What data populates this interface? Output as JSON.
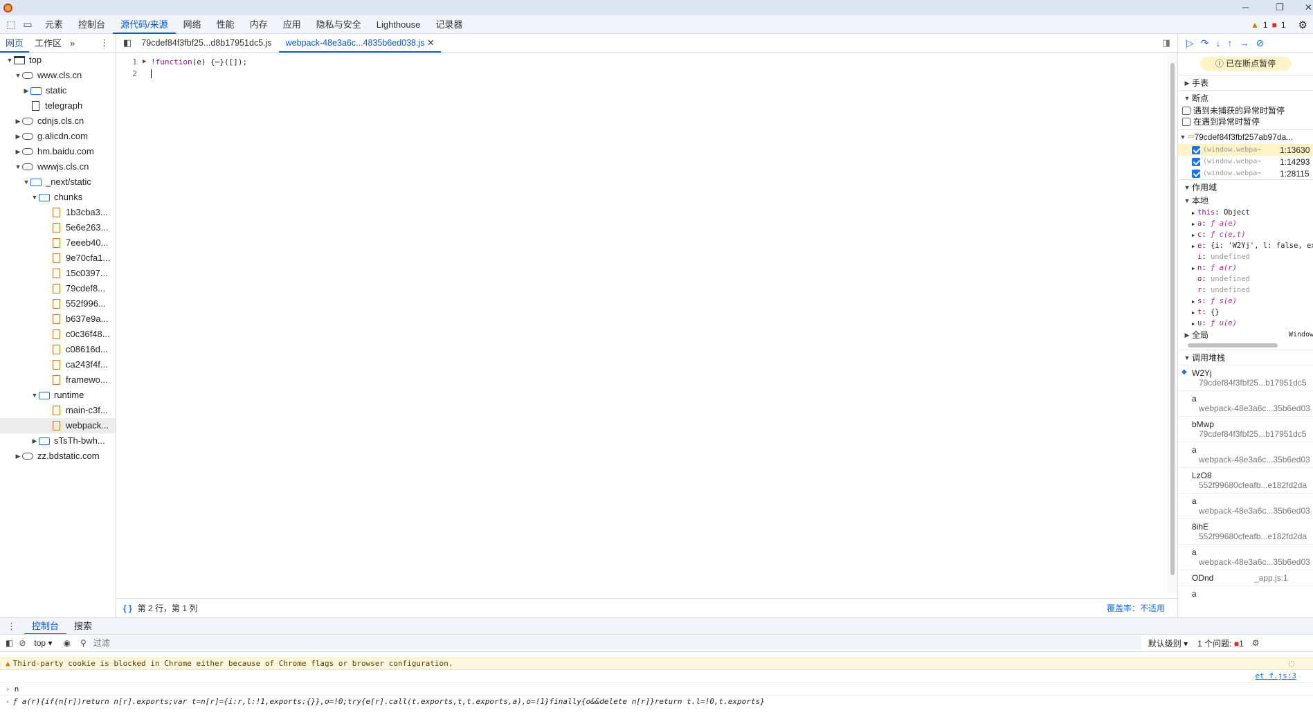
{
  "toolbar": {
    "tabs": [
      "元素",
      "控制台",
      "源代码/来源",
      "网络",
      "性能",
      "内存",
      "应用",
      "隐私与安全",
      "Lighthouse",
      "记录器"
    ],
    "active_tab": "源代码/来源",
    "warn_count": "1",
    "error_count": "1"
  },
  "navigator": {
    "tabs": [
      "网页",
      "工作区"
    ],
    "active_tab": "网页",
    "tree": [
      {
        "label": "top",
        "depth": 0,
        "type": "page",
        "expanded": true
      },
      {
        "label": "www.cls.cn",
        "depth": 1,
        "type": "cloud",
        "expanded": true
      },
      {
        "label": "static",
        "depth": 2,
        "type": "folder",
        "expanded": false
      },
      {
        "label": "telegraph",
        "depth": 2,
        "type": "doc"
      },
      {
        "label": "cdnjs.cls.cn",
        "depth": 1,
        "type": "cloud",
        "expanded": false
      },
      {
        "label": "g.alicdn.com",
        "depth": 1,
        "type": "cloud",
        "expanded": false
      },
      {
        "label": "hm.baidu.com",
        "depth": 1,
        "type": "cloud",
        "expanded": false
      },
      {
        "label": "wwwjs.cls.cn",
        "depth": 1,
        "type": "cloud",
        "expanded": true
      },
      {
        "label": "_next/static",
        "depth": 2,
        "type": "folder",
        "expanded": true
      },
      {
        "label": "chunks",
        "depth": 3,
        "type": "folder",
        "expanded": true
      },
      {
        "label": "1b3cba3...",
        "depth": 4,
        "type": "file"
      },
      {
        "label": "5e6e263...",
        "depth": 4,
        "type": "file"
      },
      {
        "label": "7eeeb40...",
        "depth": 4,
        "type": "file"
      },
      {
        "label": "9e70cfa1...",
        "depth": 4,
        "type": "file"
      },
      {
        "label": "15c0397...",
        "depth": 4,
        "type": "file"
      },
      {
        "label": "79cdef8...",
        "depth": 4,
        "type": "file"
      },
      {
        "label": "552f996...",
        "depth": 4,
        "type": "file"
      },
      {
        "label": "b637e9a...",
        "depth": 4,
        "type": "file"
      },
      {
        "label": "c0c36f48...",
        "depth": 4,
        "type": "file"
      },
      {
        "label": "c08616d...",
        "depth": 4,
        "type": "file"
      },
      {
        "label": "ca243f4f...",
        "depth": 4,
        "type": "file"
      },
      {
        "label": "framewo...",
        "depth": 4,
        "type": "file"
      },
      {
        "label": "runtime",
        "depth": 3,
        "type": "folder",
        "expanded": true
      },
      {
        "label": "main-c3f...",
        "depth": 4,
        "type": "file"
      },
      {
        "label": "webpack...",
        "depth": 4,
        "type": "file",
        "selected": true
      },
      {
        "label": "sTsTh-bwh...",
        "depth": 3,
        "type": "folder",
        "expanded": false
      },
      {
        "label": "zz.bdstatic.com",
        "depth": 1,
        "type": "cloud",
        "expanded": false
      }
    ]
  },
  "editor": {
    "tabs": [
      "79cdef84f3fbf25...d8b17951dc5.js",
      "webpack-48e3a6c...4835b6ed038.js"
    ],
    "active_tab": "webpack-48e3a6c...4835b6ed038.js",
    "lines": [
      {
        "num": "1",
        "code": "!function(e) {⋯}([]);"
      },
      {
        "num": "2",
        "code": ""
      }
    ],
    "status_position": "第 2 行，第 1 列",
    "coverage": "覆盖率：不适用"
  },
  "debugger": {
    "paused_label": "已在断点暂停",
    "watch_label": "手表",
    "breakpoints_label": "断点",
    "pause_uncaught": "遇到未捕获的异常时暂停",
    "pause_caught": "在遇到异常时暂停",
    "bp_file": "79cdef84f3fbf257ab97da...",
    "breakpoints": [
      {
        "code": "(window.webpa⋯",
        "line": "1:13630",
        "active": true
      },
      {
        "code": "(window.webpa⋯",
        "line": "1:14293"
      },
      {
        "code": "(window.webpa⋯",
        "line": "1:28115"
      }
    ],
    "scope_label": "作用域",
    "local_label": "本地",
    "scope_vars": [
      {
        "name": "this",
        "value": "Object",
        "expandable": true,
        "kind": "obj"
      },
      {
        "name": "a",
        "value": "ƒ a(e)",
        "expandable": true,
        "kind": "fn"
      },
      {
        "name": "c",
        "value": "ƒ c(e,t)",
        "expandable": true,
        "kind": "fn"
      },
      {
        "name": "e",
        "value": "{i: 'W2Yj', l: false, exp",
        "expandable": true,
        "kind": "obj"
      },
      {
        "name": "i",
        "value": "undefined",
        "expandable": false,
        "kind": "undef"
      },
      {
        "name": "n",
        "value": "ƒ a(r)",
        "expandable": true,
        "kind": "fn"
      },
      {
        "name": "o",
        "value": "undefined",
        "expandable": false,
        "kind": "undef"
      },
      {
        "name": "r",
        "value": "undefined",
        "expandable": false,
        "kind": "undef"
      },
      {
        "name": "s",
        "value": "ƒ s(e)",
        "expandable": true,
        "kind": "fn"
      },
      {
        "name": "t",
        "value": "{}",
        "expandable": true,
        "kind": "obj"
      },
      {
        "name": "u",
        "value": "ƒ u(e)",
        "expandable": true,
        "kind": "fn"
      }
    ],
    "global_label": "全局",
    "global_value": "Window",
    "callstack_label": "调用堆栈",
    "frames": [
      {
        "fn": "W2Yj",
        "loc": "79cdef84f3fbf25...b17951dc5",
        "current": true
      },
      {
        "fn": "a",
        "loc": "webpack-48e3a6c...35b6ed03"
      },
      {
        "fn": "bMwp",
        "loc": "79cdef84f3fbf25...b17951dc5"
      },
      {
        "fn": "a",
        "loc": "webpack-48e3a6c...35b6ed03"
      },
      {
        "fn": "LzO8",
        "loc": "552f99680cfeafb...e182fd2da"
      },
      {
        "fn": "a",
        "loc": "webpack-48e3a6c...35b6ed03"
      },
      {
        "fn": "8ihE",
        "loc": "552f99680cfeafb...e182fd2da"
      },
      {
        "fn": "a",
        "loc": "webpack-48e3a6c...35b6ed03"
      },
      {
        "fn": "ODnd",
        "loc": "_app.js:1",
        "inline": true
      },
      {
        "fn": "a",
        "loc": ""
      }
    ]
  },
  "drawer": {
    "tabs": [
      "控制台",
      "搜索"
    ],
    "active_tab": "控制台",
    "context": "top",
    "filter_placeholder": "过滤",
    "level": "默认级别",
    "issues": "1 个问题:",
    "issue_count": "1"
  },
  "console": {
    "warning": "Third-party cookie is blocked in Chrome either because of Chrome flags or browser configuration.",
    "link": "et f.js:3",
    "input": "n",
    "output": "ƒ a(r){if(n[r])return n[r].exports;var t=n[r]={i:r,l:!1,exports:{}},o=!0;try{e[r].call(t.exports,t,t.exports,a),o=!1}finally{o&&delete n[r]}return t.l=!0,t.exports}"
  }
}
